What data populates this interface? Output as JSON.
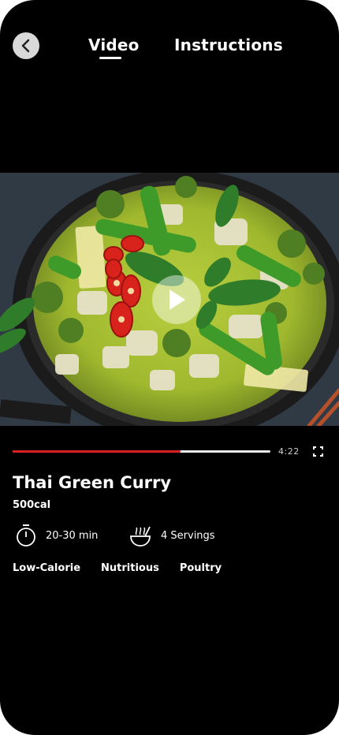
{
  "header": {
    "tabs": [
      {
        "label": "Video",
        "active": true
      },
      {
        "label": "Instructions",
        "active": false
      }
    ],
    "back_icon": "chevron-left-icon"
  },
  "video": {
    "thumbnail": "green curry dish in pan",
    "play_icon": "play-icon",
    "progress": 0.65,
    "duration": "4:22",
    "fullscreen_icon": "fullscreen-icon",
    "progress_color": "#d81f26"
  },
  "recipe": {
    "title": "Thai Green Curry",
    "calories": "500cal",
    "time": "20-30 min",
    "servings": "4 Servings",
    "time_icon": "stopwatch-icon",
    "servings_icon": "bowl-icon",
    "tags": [
      "Low-Calorie",
      "Nutritious",
      "Poultry"
    ]
  }
}
